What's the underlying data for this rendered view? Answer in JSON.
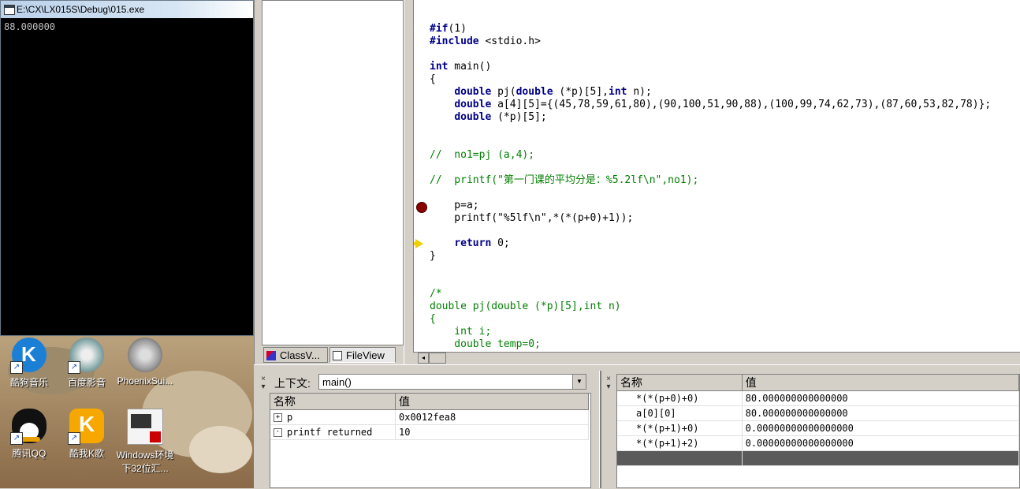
{
  "console": {
    "title": "E:\\CX\\LX015S\\Debug\\015.exe",
    "output": "88.000000"
  },
  "desktop": {
    "icons": [
      {
        "label": "酷狗音乐",
        "icon": "kugou-icon"
      },
      {
        "label": "百度影音",
        "icon": "baidu-player-icon"
      },
      {
        "label": "PhoenixSui...",
        "icon": "phoenixsuit-icon"
      },
      {
        "label": "腾讯QQ",
        "icon": "qq-penguin-icon"
      },
      {
        "label": "酷我K歌",
        "icon": "kuwo-k-icon"
      },
      {
        "label": "Windows环境下32位汇...",
        "icon": "pdf-book-icon"
      }
    ]
  },
  "workspace": {
    "tabs": [
      {
        "label": "ClassV..."
      },
      {
        "label": "FileView"
      }
    ]
  },
  "editor": {
    "lines": [
      [
        {
          "c": "kw",
          "t": "#if"
        },
        {
          "c": "pl",
          "t": "(1)"
        }
      ],
      [
        {
          "c": "kw",
          "t": "#include"
        },
        {
          "c": "pl",
          "t": " <stdio.h>"
        }
      ],
      [],
      [
        {
          "c": "kw",
          "t": "int"
        },
        {
          "c": "pl",
          "t": " main()"
        }
      ],
      [
        {
          "c": "pl",
          "t": "{"
        }
      ],
      [
        {
          "c": "pl",
          "t": "    "
        },
        {
          "c": "kw",
          "t": "double"
        },
        {
          "c": "pl",
          "t": " pj("
        },
        {
          "c": "kw",
          "t": "double"
        },
        {
          "c": "pl",
          "t": " (*p)[5],"
        },
        {
          "c": "kw",
          "t": "int"
        },
        {
          "c": "pl",
          "t": " n);"
        }
      ],
      [
        {
          "c": "pl",
          "t": "    "
        },
        {
          "c": "kw",
          "t": "double"
        },
        {
          "c": "pl",
          "t": " a[4][5]={(45,78,59,61,80),(90,100,51,90,88),(100,99,74,62,73),(87,60,53,82,78)};"
        }
      ],
      [
        {
          "c": "pl",
          "t": "    "
        },
        {
          "c": "kw",
          "t": "double"
        },
        {
          "c": "pl",
          "t": " (*p)[5];"
        }
      ],
      [],
      [],
      [
        {
          "c": "cm",
          "t": "//  no1=pj (a,4);"
        }
      ],
      [],
      [
        {
          "c": "cm",
          "t": "//  printf(\"第一门课的平均分是：%5.2lf\\n\",no1);"
        }
      ],
      [],
      [
        {
          "c": "pl",
          "t": "    p=a;"
        }
      ],
      [
        {
          "c": "pl",
          "t": "    printf(\"%5lf\\n\",*(*(p+0)+1));"
        }
      ],
      [],
      [
        {
          "c": "pl",
          "t": "    "
        },
        {
          "c": "kw",
          "t": "return"
        },
        {
          "c": "pl",
          "t": " 0;"
        }
      ],
      [
        {
          "c": "pl",
          "t": "}"
        }
      ],
      [],
      [],
      [
        {
          "c": "cm",
          "t": "/*"
        }
      ],
      [
        {
          "c": "cm",
          "t": "double pj(double (*p)[5],int n)"
        }
      ],
      [
        {
          "c": "cm",
          "t": "{"
        }
      ],
      [
        {
          "c": "cm",
          "t": "    int i;"
        }
      ],
      [
        {
          "c": "cm",
          "t": "    double temp=0;"
        }
      ]
    ]
  },
  "context": {
    "label": "上下文:",
    "value": "main()"
  },
  "variables": {
    "headers": [
      "名称",
      "值"
    ],
    "rows": [
      {
        "expander": "+",
        "name": "p",
        "value": "0x0012fea8"
      },
      {
        "expander": "·",
        "name": "printf returned",
        "value": "10"
      }
    ]
  },
  "watch": {
    "headers": [
      "名称",
      "值"
    ],
    "rows": [
      {
        "name": "*(*(p+0)+0)",
        "value": "80.000000000000000"
      },
      {
        "name": "a[0][0]",
        "value": "80.000000000000000"
      },
      {
        "name": "*(*(p+1)+0)",
        "value": "0.00000000000000000"
      },
      {
        "name": "*(*(p+1)+2)",
        "value": "0.00000000000000000"
      }
    ]
  }
}
